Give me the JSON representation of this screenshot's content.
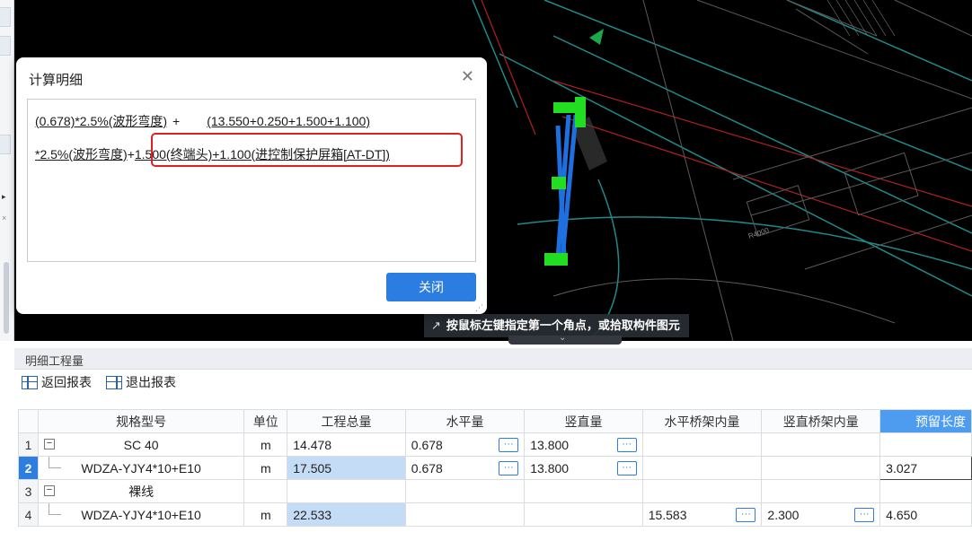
{
  "cad": {
    "status_hint": "按鼠标左键指定第一个角点，或拾取构件图元",
    "drawing_label": "R4000"
  },
  "dialog": {
    "title": "计算明细",
    "formula": {
      "line1_part1": "(0.678)*2.5%(波形弯度)",
      "plus": "+",
      "line1_part2": "(13.550+0.250+1.500+1.100)",
      "line2_part1": "*2.5%(波形弯度)",
      "line2_part2": "+",
      "line2_part3": "1.500(终端头)+1.100(进控制保护屏箱[AT-DT])"
    },
    "close_button": "关闭"
  },
  "panel": {
    "title": "明细工程量",
    "toolbar": {
      "back_report": "返回报表",
      "exit_report": "退出报表"
    }
  },
  "table": {
    "columns": [
      "规格型号",
      "单位",
      "工程总量",
      "水平量",
      "竖直量",
      "水平桥架内量",
      "竖直桥架内量",
      "预留长度"
    ],
    "rows": [
      {
        "no": "1",
        "spec": "SC 40",
        "unit": "m",
        "total": "14.478",
        "horizontal": "0.678",
        "vertical": "13.800",
        "h_tray": "",
        "v_tray": "",
        "reserve": ""
      },
      {
        "no": "2",
        "spec": "WDZA-YJY4*10+E10",
        "unit": "m",
        "total": "17.505",
        "horizontal": "0.678",
        "vertical": "13.800",
        "h_tray": "",
        "v_tray": "",
        "reserve": "3.027"
      },
      {
        "no": "3",
        "spec": "裸线",
        "unit": "",
        "total": "",
        "horizontal": "",
        "vertical": "",
        "h_tray": "",
        "v_tray": "",
        "reserve": ""
      },
      {
        "no": "4",
        "spec": "WDZA-YJY4*10+E10",
        "unit": "m",
        "total": "22.533",
        "horizontal": "",
        "vertical": "",
        "h_tray": "15.583",
        "v_tray": "2.300",
        "reserve": "4.650"
      }
    ],
    "ellipsis": "···",
    "expand_glyph": "−"
  },
  "colors": {
    "accent": "#2b7de1",
    "highlight_border": "#e02020",
    "selected_cell": "#c5dcf6",
    "cad_background": "#000000"
  }
}
